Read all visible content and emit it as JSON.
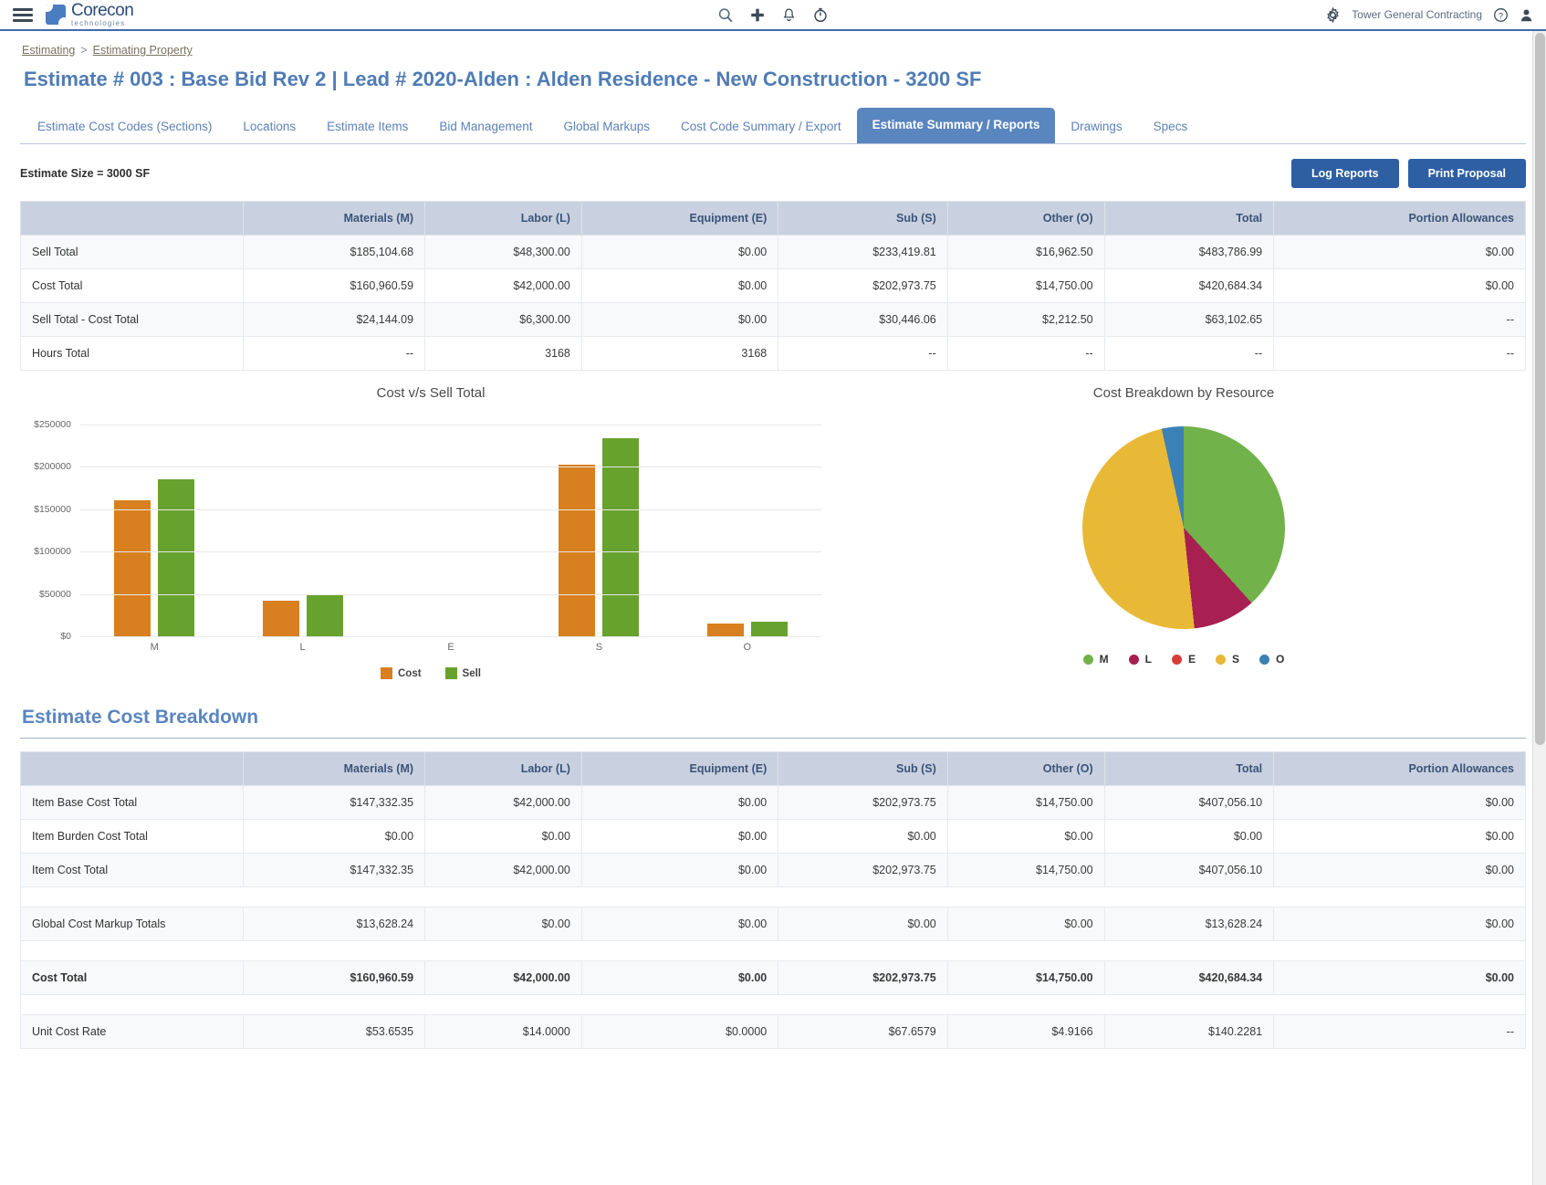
{
  "appbar": {
    "menu_icon": "hamburger-icon",
    "brand_name": "Corecon",
    "brand_sub": "technologies",
    "icons": [
      "search-icon",
      "add-icon",
      "notification-bell-icon",
      "timer-icon"
    ],
    "company": "Tower General Contracting",
    "settings_icon": "gear-icon",
    "help_icon": "help-icon",
    "user_icon": "user-avatar-icon"
  },
  "breadcrumb": {
    "first": "Estimating",
    "separator": ">",
    "second": "Estimating Property"
  },
  "page_title": "Estimate # 003 : Base Bid Rev 2  |  Lead # 2020-Alden : Alden Residence - New Construction - 3200 SF",
  "tabs": [
    {
      "label": "Estimate Cost Codes (Sections)",
      "active": false
    },
    {
      "label": "Locations",
      "active": false
    },
    {
      "label": "Estimate Items",
      "active": false
    },
    {
      "label": "Bid Management",
      "active": false
    },
    {
      "label": "Global Markups",
      "active": false
    },
    {
      "label": "Cost Code Summary / Export",
      "active": false
    },
    {
      "label": "Estimate Summary / Reports",
      "active": true
    },
    {
      "label": "Drawings",
      "active": false
    },
    {
      "label": "Specs",
      "active": false
    }
  ],
  "subbar": {
    "estimate_size": "Estimate Size = 3000  SF",
    "log_reports_label": "Log Reports",
    "print_proposal_label": "Print Proposal"
  },
  "summary_table": {
    "headers": [
      "",
      "Materials (M)",
      "Labor (L)",
      "Equipment (E)",
      "Sub (S)",
      "Other (O)",
      "Total",
      "Portion Allowances"
    ],
    "rows": [
      {
        "label": "Sell Total",
        "cells": [
          "$185,104.68",
          "$48,300.00",
          "$0.00",
          "$233,419.81",
          "$16,962.50",
          "$483,786.99",
          "$0.00"
        ]
      },
      {
        "label": "Cost Total",
        "cells": [
          "$160,960.59",
          "$42,000.00",
          "$0.00",
          "$202,973.75",
          "$14,750.00",
          "$420,684.34",
          "$0.00"
        ]
      },
      {
        "label": "Sell Total - Cost Total",
        "cells": [
          "$24,144.09",
          "$6,300.00",
          "$0.00",
          "$30,446.06",
          "$2,212.50",
          "$63,102.65",
          "--"
        ]
      },
      {
        "label": "Hours Total",
        "cells": [
          "--",
          "3168",
          "3168",
          "--",
          "--",
          "--",
          "--"
        ]
      }
    ]
  },
  "chart_data": [
    {
      "type": "bar",
      "title": "Cost v/s Sell Total",
      "categories": [
        "M",
        "L",
        "E",
        "S",
        "O"
      ],
      "series": [
        {
          "name": "Cost",
          "color": "#d8801f",
          "values": [
            160960.59,
            42000.0,
            0.0,
            202973.75,
            14750.0
          ]
        },
        {
          "name": "Sell",
          "color": "#68a22e",
          "values": [
            185104.68,
            48300.0,
            0.0,
            233419.81,
            16962.5
          ]
        }
      ],
      "yticks": [
        "$0",
        "$50000",
        "$100000",
        "$150000",
        "$200000",
        "$250000"
      ],
      "ylim": [
        0,
        250000
      ],
      "xlabel": "",
      "ylabel": "",
      "grid": true,
      "legend_position": "bottom"
    },
    {
      "type": "pie",
      "title": "Cost Breakdown by Resource",
      "labels": [
        "M",
        "L",
        "E",
        "S",
        "O"
      ],
      "values": [
        160960.59,
        42000.0,
        0.0,
        202973.75,
        14750.0
      ],
      "percents": [
        38.3,
        10.0,
        0.0,
        48.2,
        3.5
      ],
      "colors": [
        "#72b24b",
        "#a81f52",
        "#d93b3b",
        "#e8b936",
        "#3b81b5"
      ],
      "legend_position": "bottom"
    }
  ],
  "breakdown": {
    "title": "Estimate Cost Breakdown",
    "headers": [
      "",
      "Materials (M)",
      "Labor (L)",
      "Equipment (E)",
      "Sub (S)",
      "Other (O)",
      "Total",
      "Portion Allowances"
    ],
    "rows": [
      {
        "label": "Item Base Cost Total",
        "cells": [
          "$147,332.35",
          "$42,000.00",
          "$0.00",
          "$202,973.75",
          "$14,750.00",
          "$407,056.10",
          "$0.00"
        ],
        "bold": false,
        "spacer": false
      },
      {
        "label": "Item Burden Cost Total",
        "cells": [
          "$0.00",
          "$0.00",
          "$0.00",
          "$0.00",
          "$0.00",
          "$0.00",
          "$0.00"
        ],
        "bold": false,
        "spacer": false
      },
      {
        "label": "Item Cost Total",
        "cells": [
          "$147,332.35",
          "$42,000.00",
          "$0.00",
          "$202,973.75",
          "$14,750.00",
          "$407,056.10",
          "$0.00"
        ],
        "bold": false,
        "spacer": false
      },
      {
        "label": "",
        "cells": [
          "",
          "",
          "",
          "",
          "",
          "",
          ""
        ],
        "bold": false,
        "spacer": true
      },
      {
        "label": "Global Cost Markup Totals",
        "cells": [
          "$13,628.24",
          "$0.00",
          "$0.00",
          "$0.00",
          "$0.00",
          "$13,628.24",
          "$0.00"
        ],
        "bold": false,
        "spacer": false
      },
      {
        "label": "",
        "cells": [
          "",
          "",
          "",
          "",
          "",
          "",
          ""
        ],
        "bold": false,
        "spacer": true
      },
      {
        "label": "Cost Total",
        "cells": [
          "$160,960.59",
          "$42,000.00",
          "$0.00",
          "$202,973.75",
          "$14,750.00",
          "$420,684.34",
          "$0.00"
        ],
        "bold": true,
        "spacer": false
      },
      {
        "label": "",
        "cells": [
          "",
          "",
          "",
          "",
          "",
          "",
          ""
        ],
        "bold": false,
        "spacer": true
      },
      {
        "label": "Unit Cost Rate",
        "cells": [
          "$53.6535",
          "$14.0000",
          "$0.0000",
          "$67.6579",
          "$4.9166",
          "$140.2281",
          "--"
        ],
        "bold": false,
        "spacer": false
      }
    ]
  }
}
